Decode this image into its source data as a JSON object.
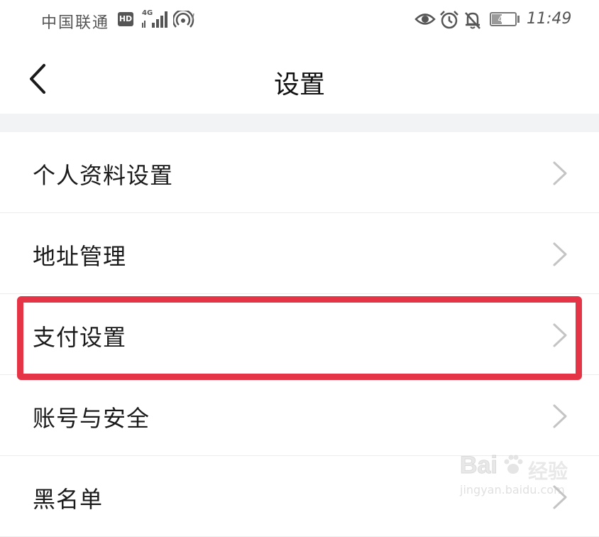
{
  "status_bar": {
    "carrier": "中国联通",
    "hd_badge": "HD",
    "network_type": "4G",
    "battery_level": "47",
    "battery_fraction": 0.47,
    "time": "11:49"
  },
  "header": {
    "title": "设置"
  },
  "menu": {
    "items": [
      {
        "label": "个人资料设置"
      },
      {
        "label": "地址管理"
      },
      {
        "label": "支付设置"
      },
      {
        "label": "账号与安全"
      },
      {
        "label": "黑名单"
      }
    ]
  },
  "highlight": {
    "target": "支付设置",
    "color": "#e53445"
  },
  "watermark": {
    "brand": "Bai",
    "brand_suffix": "经验",
    "url": "jingyan.baidu.com"
  },
  "icons": {
    "back": "back-arrow-icon",
    "chevron": "chevron-right-icon",
    "signal": "signal-icon",
    "hotspot": "hotspot-icon",
    "eye": "eye-comfort-icon",
    "alarm": "alarm-clock-icon",
    "mute": "bell-muted-icon"
  }
}
